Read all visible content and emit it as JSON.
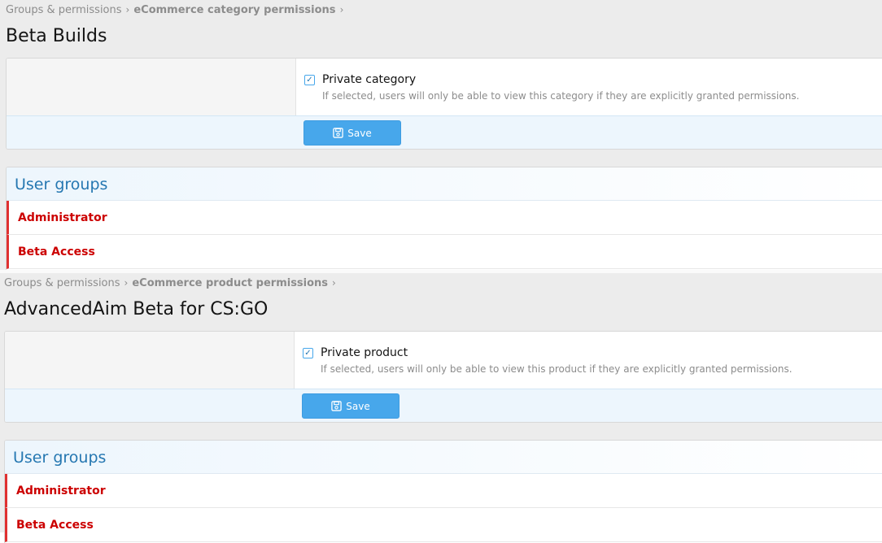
{
  "sections": [
    {
      "breadcrumb": [
        {
          "label": "Groups & permissions"
        },
        {
          "label": "eCommerce category permissions"
        }
      ],
      "title": "Beta Builds",
      "option": {
        "checked": true,
        "label": "Private category",
        "hint": "If selected, users will only be able to view this category if they are explicitly granted permissions."
      },
      "save_label": "Save",
      "groups_title": "User groups",
      "groups": [
        {
          "label": "Administrator"
        },
        {
          "label": "Beta Access"
        }
      ]
    },
    {
      "breadcrumb": [
        {
          "label": "Groups & permissions"
        },
        {
          "label": "eCommerce product permissions"
        }
      ],
      "title": "AdvancedAim Beta for CS:GO",
      "option": {
        "checked": true,
        "label": "Private product",
        "hint": "If selected, users will only be able to view this product if they are explicitly granted permissions."
      },
      "save_label": "Save",
      "groups_title": "User groups",
      "groups": [
        {
          "label": "Administrator"
        },
        {
          "label": "Beta Access"
        }
      ]
    }
  ],
  "colors": {
    "accent": "#47a7eb",
    "group_text": "#cc0000",
    "group_bar": "#e03030",
    "heading": "#2577b1"
  },
  "icons": {
    "save": "save-icon",
    "check": "check-icon",
    "breadcrumb_separator": "chevron-right-icon"
  }
}
